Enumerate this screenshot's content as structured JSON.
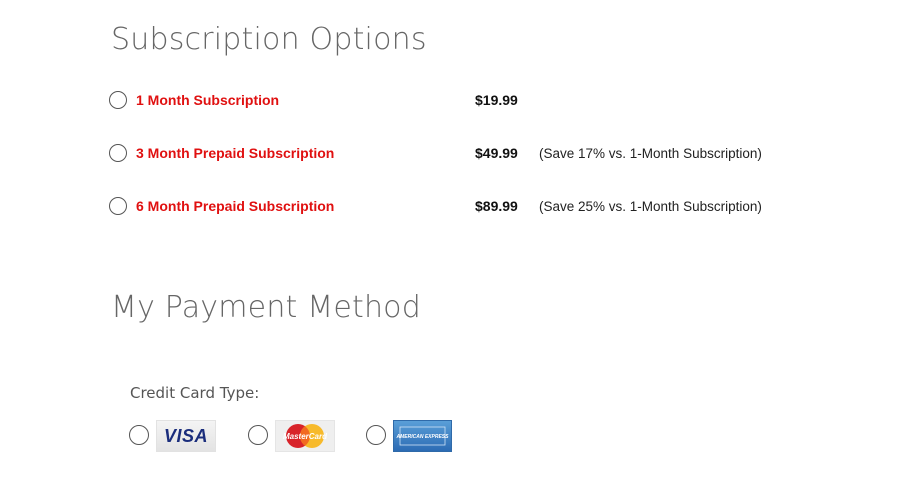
{
  "subscription": {
    "title": "Subscription Options",
    "plans": [
      {
        "label": "1 Month Subscription",
        "price": "$19.99",
        "note": ""
      },
      {
        "label": "3 Month Prepaid Subscription",
        "price": "$49.99",
        "note": "(Save 17% vs. 1-Month Subscription)"
      },
      {
        "label": "6 Month Prepaid Subscription",
        "price": "$89.99",
        "note": "(Save 25% vs. 1-Month Subscription)"
      }
    ]
  },
  "payment": {
    "title": "My Payment Method",
    "card_type_label": "Credit Card Type:",
    "cards": [
      {
        "label": "VISA",
        "icon": "visa-logo-icon"
      },
      {
        "label": "MasterCard",
        "icon": "mastercard-logo-icon"
      },
      {
        "label": "AMERICAN EXPRESS",
        "icon": "amex-logo-icon"
      }
    ]
  },
  "colors": {
    "plan_name": "#e01010",
    "heading": "#666666",
    "visa_blue": "#1a2d7c",
    "amex_blue": "#2c6bb4",
    "mc_red": "#d8232a",
    "mc_yellow": "#f7b51a"
  }
}
